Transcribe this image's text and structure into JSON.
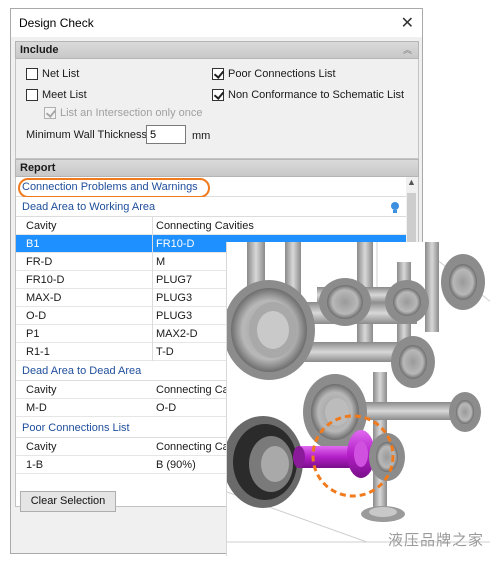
{
  "dialog": {
    "title": "Design Check",
    "close_glyph": "✕"
  },
  "include": {
    "header": "Include",
    "list_net": {
      "label": "Net List",
      "checked": false
    },
    "meet_list": {
      "label": "Meet List",
      "checked": false
    },
    "intersection_only": {
      "label": "List an Intersection only once",
      "checked": true,
      "enabled": false
    },
    "poor_connections_list": {
      "label": "Poor Connections List",
      "checked": true
    },
    "non_conformance": {
      "label": "Non Conformance to Schematic List",
      "checked": true
    },
    "min_wall_label": "Minimum Wall Thickness",
    "min_wall_value": "5",
    "min_wall_unit": "mm"
  },
  "report": {
    "header": "Report",
    "problems_title": "Connection Problems and Warnings",
    "group1": {
      "title": "Dead Area to Working Area",
      "col1": "Cavity",
      "col2": "Connecting Cavities",
      "rows": [
        {
          "cavity": "B1",
          "connecting": "FR10-D"
        },
        {
          "cavity": "FR-D",
          "connecting": "M"
        },
        {
          "cavity": "FR10-D",
          "connecting": "PLUG7"
        },
        {
          "cavity": "MAX-D",
          "connecting": "PLUG3"
        },
        {
          "cavity": "O-D",
          "connecting": "PLUG3"
        },
        {
          "cavity": "P1",
          "connecting": "MAX2-D"
        },
        {
          "cavity": "R1-1",
          "connecting": "T-D"
        }
      ]
    },
    "group2": {
      "title": "Dead Area to Dead Area",
      "col1": "Cavity",
      "col2": "Connecting Ca",
      "rows": [
        {
          "cavity": "M-D",
          "connecting": "O-D"
        }
      ]
    },
    "group3": {
      "title": "Poor Connections List",
      "col1": "Cavity",
      "col2": "Connecting Ca",
      "rows": [
        {
          "cavity": "1-B",
          "connecting": "B (90%)"
        }
      ]
    }
  },
  "buttons": {
    "clear_selection": "Clear Selection"
  },
  "watermark": "液压品牌之家",
  "colors": {
    "selection": "#1e90ff",
    "group_title": "#1f4e9b",
    "highlight_oval": "#f07a1c",
    "highlighted_part": "#b41fc8"
  }
}
